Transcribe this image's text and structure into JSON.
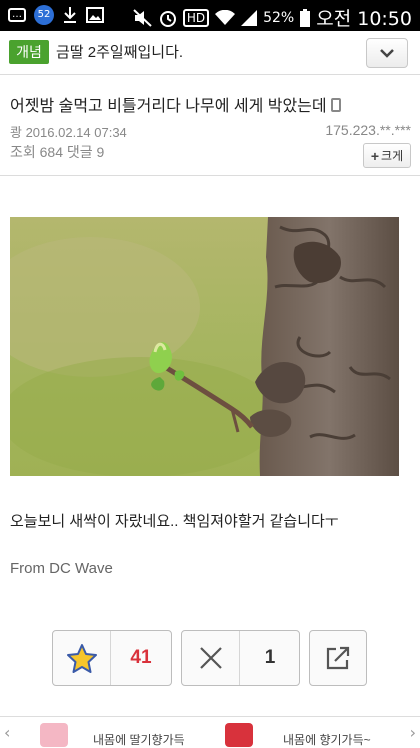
{
  "status_bar": {
    "notification_count": "52",
    "hd_label": "HD",
    "battery": "52%",
    "time": "오전 10:50"
  },
  "header": {
    "badge": "개념",
    "gallery": "금딸 2주일째입니다."
  },
  "post": {
    "title": "어젯밤 술먹고 비틀거리다 나무에 세게 박았는데",
    "author_date": "쾅 2016.02.14 07:34",
    "ip": "175.223.**.***",
    "stats": "조회 684  댓글 9",
    "enlarge_label": "크게",
    "body": "오늘보니 새싹이 자랐네요.. 책임져야할거 같습니다ㅜ",
    "from": "From DC Wave"
  },
  "actions": {
    "recommend_count": "41",
    "nonrecommend_count": "1"
  },
  "ad": {
    "item1": "내몸에 딸기향가득",
    "item2": "내몸에 향기가득~"
  },
  "icons": {
    "star": "star-icon",
    "close": "x-icon",
    "share": "share-icon",
    "dropdown": "chevron-down-icon"
  }
}
